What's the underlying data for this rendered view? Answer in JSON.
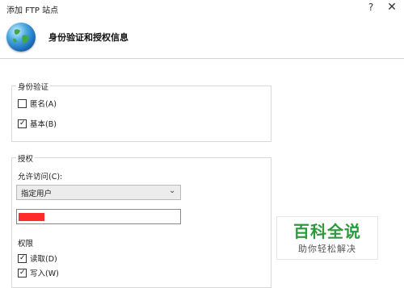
{
  "window": {
    "title": "添加 FTP 站点",
    "help_glyph": "?",
    "close_glyph": "✕"
  },
  "header": {
    "title": "身份验证和授权信息",
    "icon": "globe-icon"
  },
  "authentication": {
    "legend": "身份验证",
    "anonymous": {
      "label": "匿名(A)",
      "checked": false
    },
    "basic": {
      "label": "基本(B)",
      "checked": true
    }
  },
  "authorization": {
    "legend": "授权",
    "allow_access_label": "允许访问(C):",
    "allow_access_selected": "指定用户",
    "permissions_label": "权限",
    "read": {
      "label": "读取(D)",
      "checked": true
    },
    "write": {
      "label": "写入(W)",
      "checked": true
    }
  },
  "watermark": {
    "title": "百科全说",
    "subtitle": "助你轻松解决"
  },
  "colors": {
    "header_bg": "#ffffff",
    "redaction": "#ff2a2a",
    "watermark_green": "#2c9a3b"
  }
}
